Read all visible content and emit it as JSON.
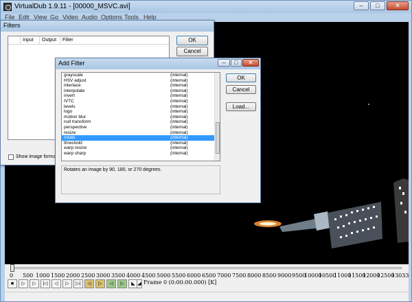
{
  "main_window": {
    "title": "VirtualDub 1.9.11 - [00000_MSVC.avi]",
    "controls": {
      "minimize": "–",
      "maximize": "□",
      "close": "✕"
    }
  },
  "menu": [
    "File",
    "Edit",
    "View",
    "Go",
    "Video",
    "Audio",
    "Options",
    "Tools",
    "Help"
  ],
  "timeline": {
    "ticks": [
      "0",
      "500",
      "1000",
      "1500",
      "2000",
      "2500",
      "3000",
      "3500",
      "4000",
      "4500",
      "5000",
      "5500",
      "6000",
      "6500",
      "7000",
      "7500",
      "8000",
      "8500",
      "9000",
      "9500",
      "10000",
      "10500",
      "11000",
      "11500",
      "12000",
      "12500",
      "13033"
    ],
    "position_fraction": 0.0,
    "frame_readout": "Frame 0 (0:00:00.000) [K]"
  },
  "filters_dialog": {
    "title": "Filters",
    "columns": [
      "Input",
      "Output",
      "Filter"
    ],
    "ok_label": "OK",
    "cancel_label": "Cancel",
    "show_image_formats_label": "Show image formats"
  },
  "add_filter_dialog": {
    "title": "Add Filter",
    "controls": {
      "minimize": "–",
      "maximize": "□",
      "close": "✕"
    },
    "ok_label": "OK",
    "cancel_label": "Cancel",
    "load_label": "Load...",
    "filters": [
      {
        "name": "grayscale",
        "type": "(internal)"
      },
      {
        "name": "HSV adjust",
        "type": "(internal)"
      },
      {
        "name": "interlace",
        "type": "(internal)"
      },
      {
        "name": "interpolate",
        "type": "(internal)"
      },
      {
        "name": "invert",
        "type": "(internal)"
      },
      {
        "name": "IVTC",
        "type": "(internal)"
      },
      {
        "name": "levels",
        "type": "(internal)"
      },
      {
        "name": "logo",
        "type": "(internal)"
      },
      {
        "name": "motion blur",
        "type": "(internal)"
      },
      {
        "name": "null transform",
        "type": "(internal)"
      },
      {
        "name": "perspective",
        "type": "(internal)"
      },
      {
        "name": "resize",
        "type": "(internal)"
      },
      {
        "name": "rotate",
        "type": "(internal)"
      },
      {
        "name": "threshold",
        "type": "(internal)"
      },
      {
        "name": "warp resize",
        "type": "(internal)"
      },
      {
        "name": "warp sharp",
        "type": "(internal)"
      }
    ],
    "selected_filter": "rotate",
    "description": "Rotates an image by 90, 180, or 270 degrees."
  },
  "colors": {
    "selection": "#3399ff",
    "frame": "#b9d1ea",
    "video_background": "#000000"
  }
}
